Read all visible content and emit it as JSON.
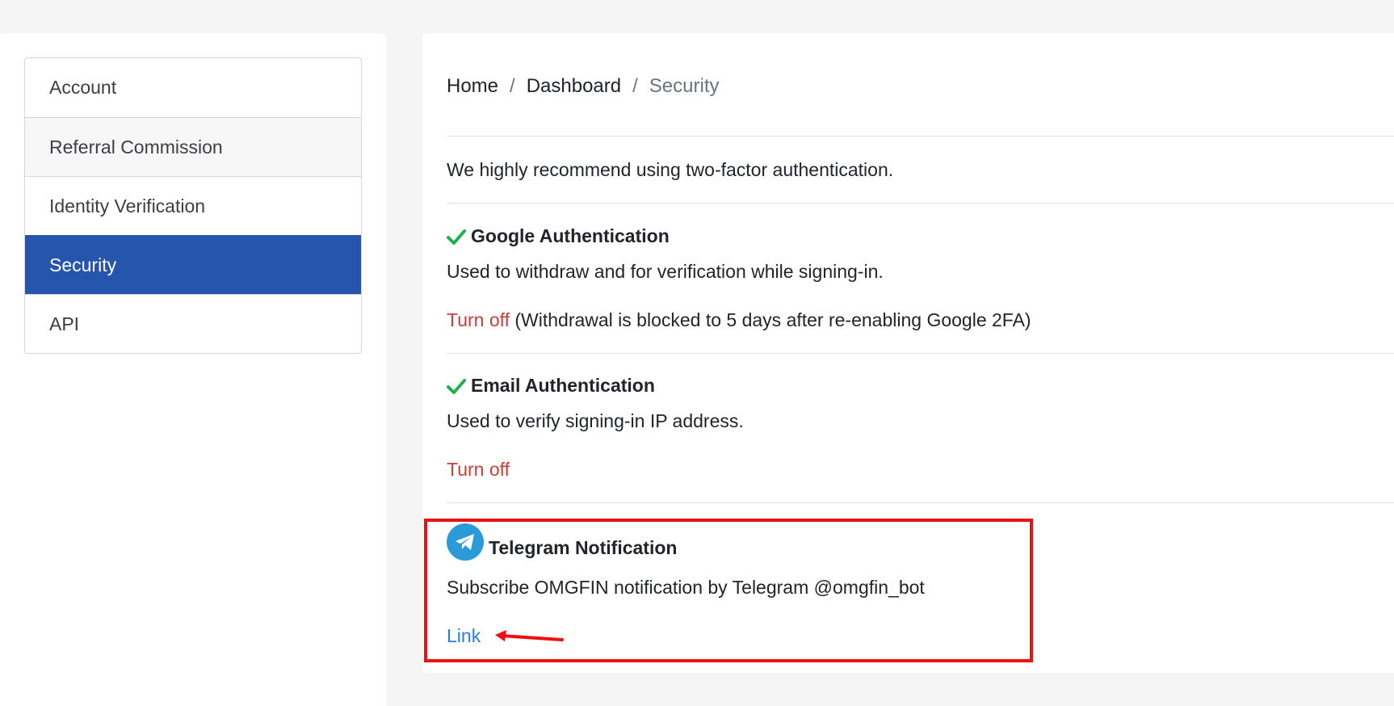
{
  "sidebar": {
    "items": [
      {
        "label": "Account"
      },
      {
        "label": "Referral Commission"
      },
      {
        "label": "Identity Verification"
      },
      {
        "label": "Security"
      },
      {
        "label": "API"
      }
    ]
  },
  "breadcrumb": {
    "home": "Home",
    "sep": "/",
    "dashboard": "Dashboard",
    "current": "Security"
  },
  "security": {
    "intro": "We highly recommend using two-factor authentication.",
    "google": {
      "title": "Google Authentication",
      "desc": "Used to withdraw and for verification while signing-in.",
      "action": "Turn off",
      "note": " (Withdrawal is blocked to 5 days after re-enabling Google 2FA)"
    },
    "email": {
      "title": "Email Authentication",
      "desc": "Used to verify signing-in IP address.",
      "action": "Turn off"
    },
    "telegram": {
      "title": "Telegram Notification",
      "desc": "Subscribe OMGFIN notification by Telegram @omgfin_bot",
      "link": "Link"
    }
  },
  "colors": {
    "active": "#2655ad",
    "turn_off": "#d03b3b",
    "link": "#2a7de1",
    "check": "#22b14c",
    "telegram": "#2b9ad8",
    "annotation": "#ee1111"
  },
  "icons": {
    "check": "check-icon",
    "telegram": "telegram-icon",
    "arrow": "arrow-annotation-icon"
  }
}
